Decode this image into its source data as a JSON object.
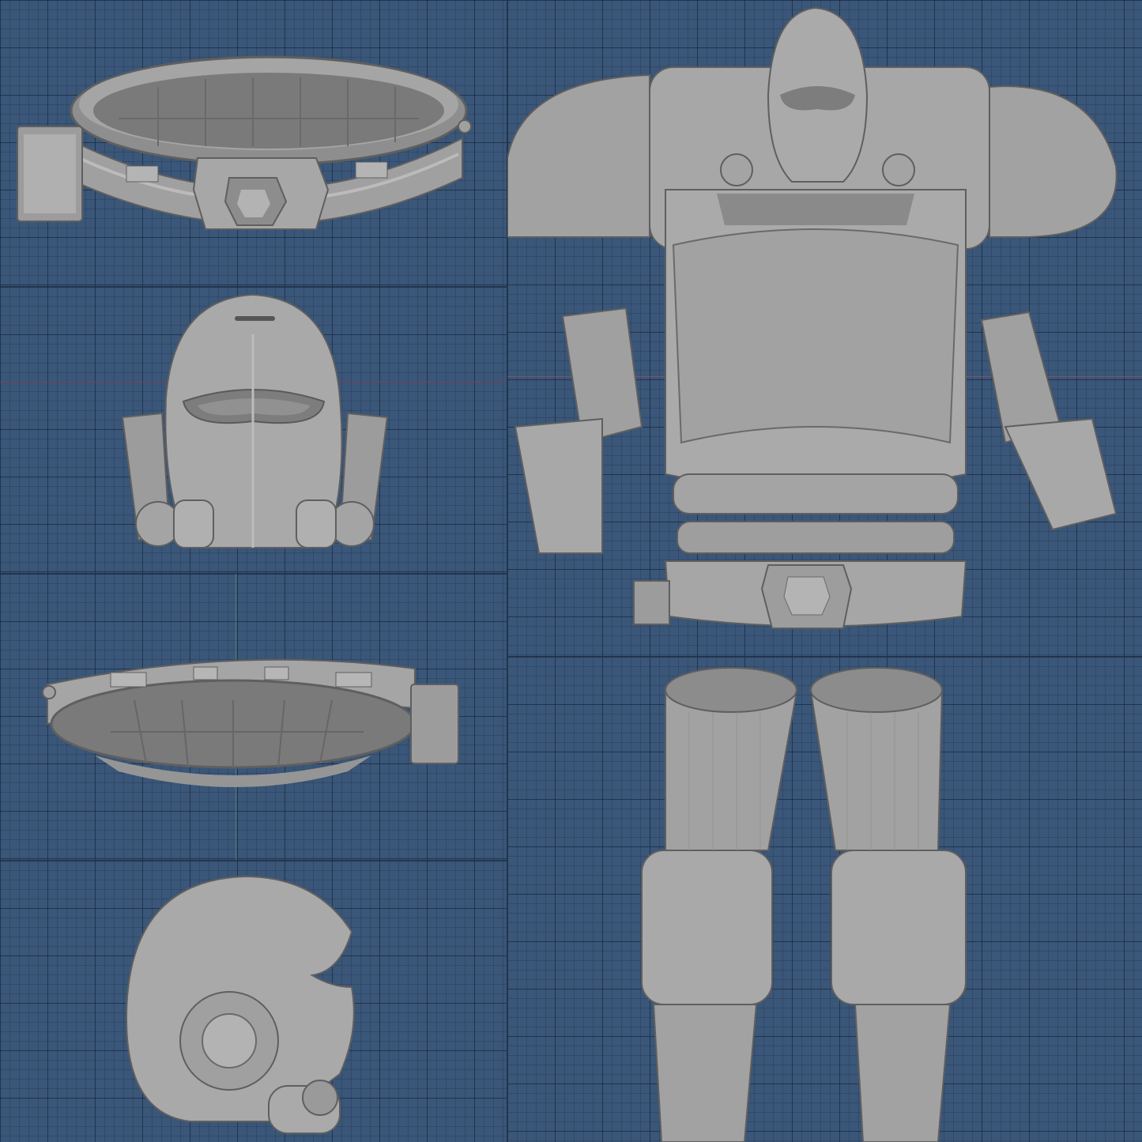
{
  "viewports": [
    {
      "id": "belt-top",
      "label": ""
    },
    {
      "id": "mask-front",
      "label": ""
    },
    {
      "id": "belt-bottom",
      "label": ""
    },
    {
      "id": "helmet-side",
      "label": ""
    },
    {
      "id": "torso",
      "label": ""
    },
    {
      "id": "legs",
      "label": ""
    }
  ],
  "colors": {
    "grid_background": "#3a5678",
    "model_gray": "#a3a3a3",
    "model_shadow": "#7d7d7d",
    "model_highlight": "#bdbdbd",
    "x_axis": "#be505a",
    "y_axis": "#6eaa6e"
  }
}
